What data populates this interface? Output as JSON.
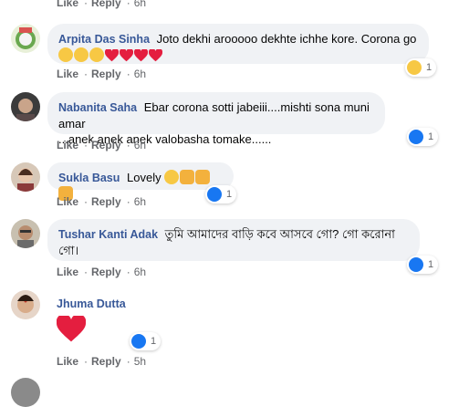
{
  "actions": {
    "like": "Like",
    "reply": "Reply"
  },
  "top_meta": {
    "time": "6h"
  },
  "comments": [
    {
      "name": "Arpita Das Sinha",
      "text": "Joto dekhi arooooo dekhte ichhe kore. Corona go",
      "time": "6h",
      "reaction_count": "1",
      "reaction_icon": "haha-icon"
    },
    {
      "name": "Nabanita Saha",
      "text_line1": "Ebar corona sotti jabeiii....mishti sona muni amar",
      "text_line2": "...anek anek anek valobasha tomake......",
      "time": "6h",
      "reaction_count": "1",
      "reaction_icon": "like-icon"
    },
    {
      "name": "Sukla Basu",
      "text": "Lovely",
      "time": "6h",
      "reaction_count": "1",
      "reaction_icon": "like-icon"
    },
    {
      "name": "Tushar Kanti Adak",
      "text_line1": "তুমি আমাদের বাড়ি কবে আসবে গো? গো করোনা",
      "text_line2": "গো।",
      "time": "6h",
      "reaction_count": "1",
      "reaction_icon": "like-icon"
    },
    {
      "name": "Jhuma Dutta",
      "time": "5h",
      "reaction_count": "1",
      "reaction_icon": "like-icon"
    }
  ],
  "colors": {
    "name": "#385898",
    "meta": "#65676b",
    "bubble": "#f0f2f5",
    "like": "#1877f2",
    "heart": "#e41e3f"
  }
}
